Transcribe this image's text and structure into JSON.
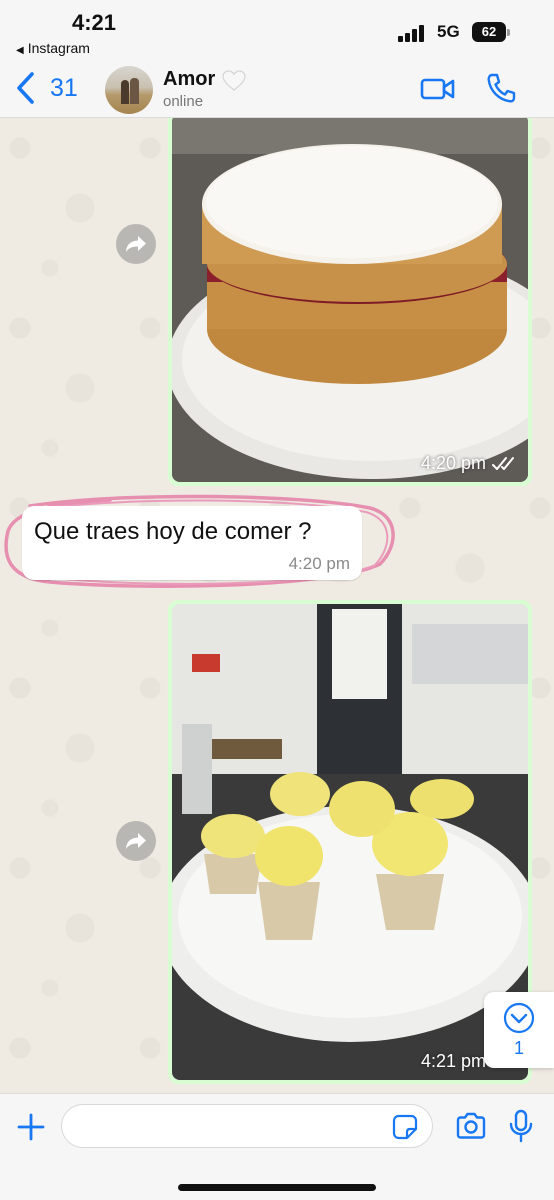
{
  "status_bar": {
    "time": "4:21",
    "back_app": "Instagram",
    "network": "5G",
    "battery": "62"
  },
  "header": {
    "back_count": "31",
    "contact_name": "Amor",
    "contact_status": "online",
    "icons": [
      "chevron-left-icon",
      "white-heart-icon",
      "video-icon",
      "phone-icon"
    ]
  },
  "messages": [
    {
      "type": "image",
      "direction": "outgoing",
      "time": "4:20 pm",
      "status": "read"
    },
    {
      "type": "text",
      "direction": "incoming",
      "text": "Que traes hoy de comer ?",
      "time": "4:20 pm"
    },
    {
      "type": "image",
      "direction": "outgoing",
      "time": "4:21 pm",
      "status": "read"
    }
  ],
  "scroll_to_bottom": {
    "unread_count": "1"
  },
  "input_bar": {
    "placeholder": "",
    "value": ""
  },
  "colors": {
    "accent": "#1877f2",
    "outgoing_bubble": "#d9fdd3",
    "incoming_bubble": "#ffffff",
    "chat_background": "#efeae2",
    "annotation_circle": "#e68fb0"
  }
}
